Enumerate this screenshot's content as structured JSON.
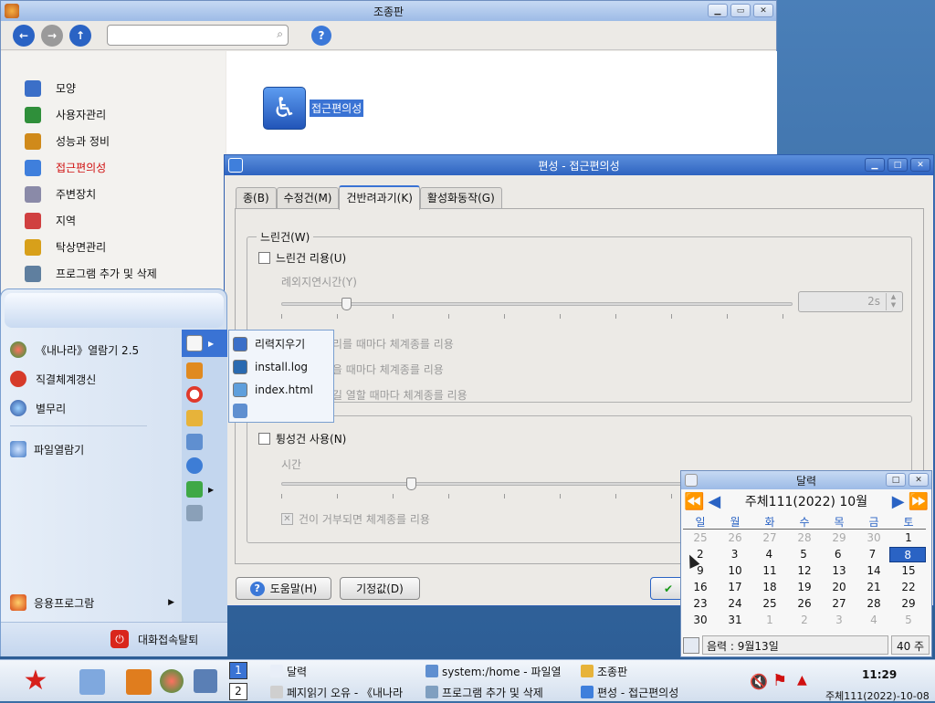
{
  "control_panel": {
    "title": "조종판",
    "sidebar": [
      {
        "label": "모양",
        "active": false
      },
      {
        "label": "사용자관리",
        "active": false
      },
      {
        "label": "성능과 정비",
        "active": false
      },
      {
        "label": "접근편의성",
        "active": true
      },
      {
        "label": "주변장치",
        "active": false
      },
      {
        "label": "지역",
        "active": false
      },
      {
        "label": "탁상면관리",
        "active": false
      },
      {
        "label": "프로그램 추가 및 삭제",
        "active": false
      }
    ],
    "main_item": "접근편의성"
  },
  "dialog": {
    "title": "편성 - 접근편의성",
    "tabs": [
      {
        "label": "종(B)",
        "active": false
      },
      {
        "label": "수정건(M)",
        "active": false
      },
      {
        "label": "건반려과기(K)",
        "active": true
      },
      {
        "label": "활성화동작(G)",
        "active": false
      }
    ],
    "slow_keys": {
      "legend": "느린건(W)",
      "use": "느린건 리용(U)",
      "delay_label": "례외지연시간(Y)",
      "delay_value": "2s",
      "delay_level": 0.12,
      "opt1": "건이 눌리를 때마다 체계종를 리용",
      "opt2": "건을 받을 때마다 체계종를 리용",
      "opt3": "건을 넘길 열할 때마다 체계종를 리용"
    },
    "bounce_keys": {
      "use": "튕성건 사용(N)",
      "time_label": "시간",
      "time_level": 0.32,
      "opt1": "건이 거부되면 체계종를 리용"
    },
    "help_btn": "도움말(H)",
    "default_btn": "기정값(D)"
  },
  "start_menu": {
    "apps": [
      {
        "label": "《내나라》열람기 2.5"
      },
      {
        "label": "직결체계갱신"
      },
      {
        "label": "별무리"
      }
    ],
    "files": "파일열람기",
    "programs": "응용프로그람",
    "logout": "대화접속탈퇴"
  },
  "submenu": {
    "items": [
      {
        "label": "리력지우기"
      },
      {
        "label": "install.log"
      },
      {
        "label": "index.html"
      }
    ]
  },
  "calendar": {
    "title": "달력",
    "header": "주체111(2022)  10월",
    "weekdays": [
      "일",
      "월",
      "화",
      "수",
      "목",
      "금",
      "토"
    ],
    "days": [
      [
        "25",
        "26",
        "27",
        "28",
        "29",
        "30",
        "1"
      ],
      [
        "2",
        "3",
        "4",
        "5",
        "6",
        "7",
        "8"
      ],
      [
        "9",
        "10",
        "11",
        "12",
        "13",
        "14",
        "15"
      ],
      [
        "16",
        "17",
        "18",
        "19",
        "20",
        "21",
        "22"
      ],
      [
        "23",
        "24",
        "25",
        "26",
        "27",
        "28",
        "29"
      ],
      [
        "30",
        "31",
        "1",
        "2",
        "3",
        "4",
        "5"
      ]
    ],
    "lunar": "음력 : 9월13일",
    "week": "40 주"
  },
  "taskbar": {
    "desk1": "1",
    "desk2": "2",
    "tasks": [
      {
        "label": "달력",
        "col": 0
      },
      {
        "label": "system:/home - 파일열",
        "col": 1
      },
      {
        "label": "조종판",
        "col": 2
      },
      {
        "label": "페지읽기 오유 - 《내나라",
        "col": 0
      },
      {
        "label": "프로그램 추가 및 삭제",
        "col": 1
      },
      {
        "label": "편성 - 접근편의성",
        "col": 2
      }
    ],
    "time": "11:29",
    "date": "주체111(2022)-10-08"
  },
  "colors": {
    "accent": "#2e63c0",
    "selection": "#3a73d4",
    "active_red": "#d01010"
  }
}
